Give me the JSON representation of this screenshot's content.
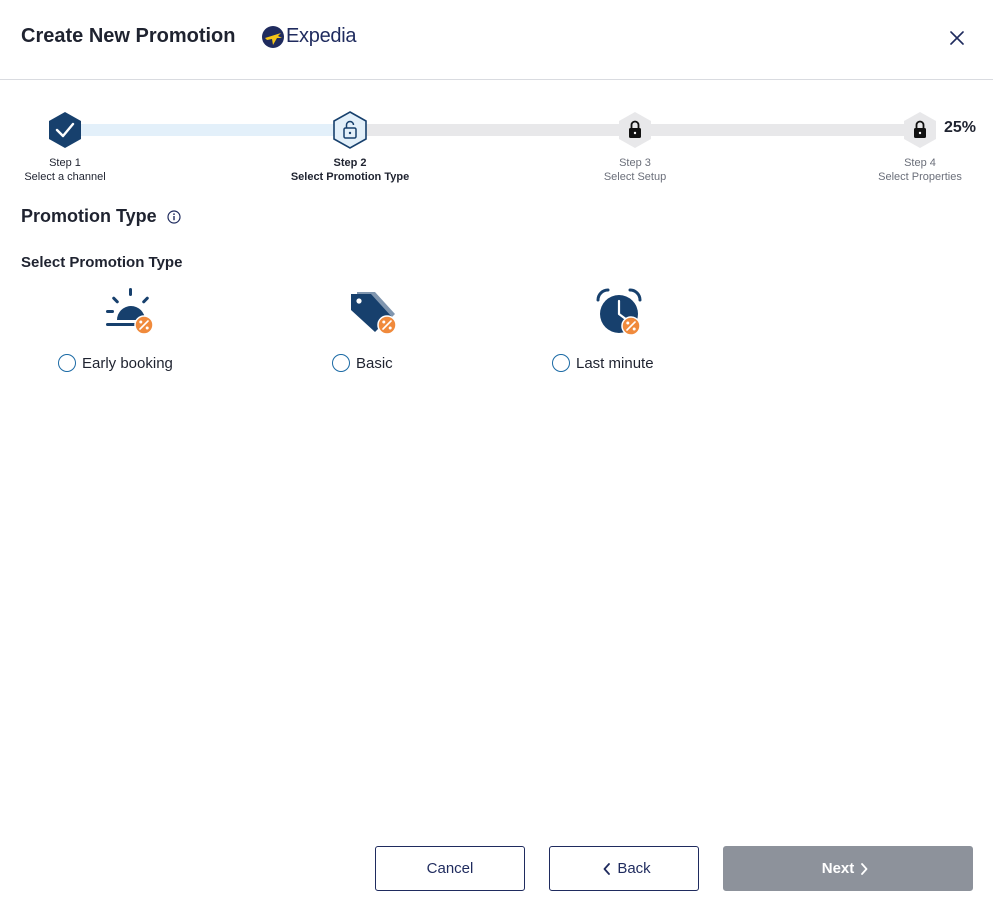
{
  "header": {
    "title": "Create New Promotion",
    "brand_name": "Expedia",
    "close_icon": "close-icon"
  },
  "progress": {
    "percent_label": "25%",
    "percent": 25,
    "steps": [
      {
        "number": "Step 1",
        "label": "Select a channel",
        "state": "completed"
      },
      {
        "number": "Step 2",
        "label": "Select Promotion Type",
        "state": "active"
      },
      {
        "number": "Step 3",
        "label": "Select Setup",
        "state": "locked"
      },
      {
        "number": "Step 4",
        "label": "Select Properties",
        "state": "locked"
      }
    ]
  },
  "main": {
    "section_title": "Promotion Type",
    "sub_title": "Select Promotion Type",
    "options": [
      {
        "label": "Early booking",
        "icon": "sunrise-discount-icon",
        "selected": false
      },
      {
        "label": "Basic",
        "icon": "tags-discount-icon",
        "selected": false
      },
      {
        "label": "Last minute",
        "icon": "alarm-clock-discount-icon",
        "selected": false
      }
    ]
  },
  "footer": {
    "cancel_label": "Cancel",
    "back_label": "Back",
    "next_label": "Next"
  },
  "colors": {
    "navy": "#1f2b5e",
    "step_dark": "#17406d",
    "accent_orange": "#f08a3c",
    "brand_yellow": "#f5c518",
    "disabled_button": "#8d929b",
    "radio_border": "#1b6aa5",
    "track_done": "#e3f0fa",
    "track_todo": "#e8e8ea"
  }
}
